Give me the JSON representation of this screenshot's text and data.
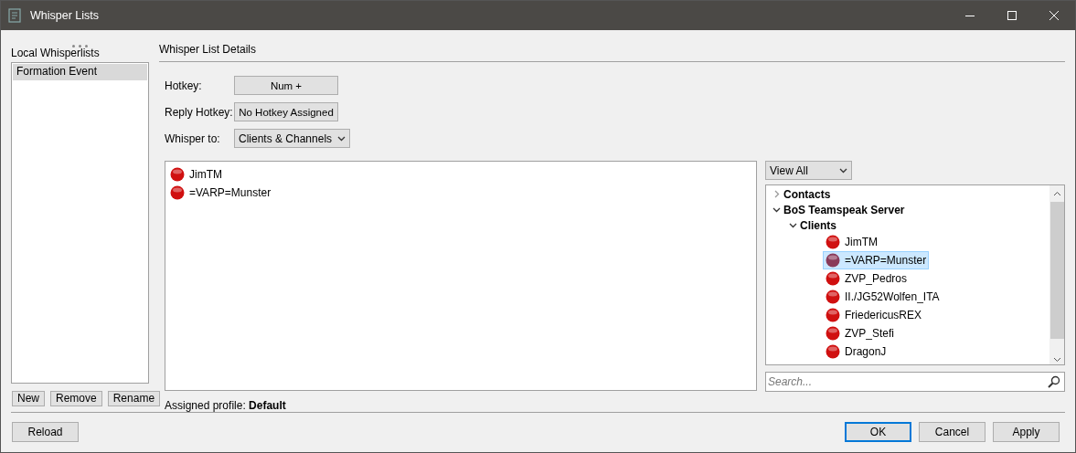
{
  "window": {
    "title": "Whisper Lists"
  },
  "local": {
    "title": "Local Whisperlists",
    "items": [
      {
        "label": "Formation Event",
        "selected": true
      }
    ],
    "buttons": [
      "New",
      "Remove",
      "Rename"
    ]
  },
  "details": {
    "title": "Whisper List Details",
    "fields": [
      {
        "kind": "button",
        "label": "Hotkey:",
        "value": "Num +"
      },
      {
        "kind": "button",
        "label": "Reply Hotkey:",
        "value": "No Hotkey Assigned"
      },
      {
        "kind": "dropdown",
        "label": "Whisper to:",
        "value": "Clients & Channels"
      }
    ],
    "targets": [
      {
        "name": "JimTM",
        "color": "#d01010"
      },
      {
        "name": "=VARP=Munster",
        "color": "#d01010"
      }
    ],
    "profile": "Assigned profile: **Default**"
  },
  "browser": {
    "filter": "View All",
    "search": {
      "placeholder": "Search..."
    },
    "tree": [
      {
        "label": "Contacts",
        "expanded": false
      },
      {
        "label": "BoS Teamspeak Server",
        "expanded": true,
        "children": [
          {
            "label": "Clients",
            "expanded": true,
            "children": [
              {
                "label": "JimTM",
                "color": "#d01010",
                "selected": false
              },
              {
                "label": "=VARP=Munster",
                "color": "#8a3a5a",
                "selected": true
              },
              {
                "label": "ZVP_Pedros",
                "color": "#d01010",
                "selected": false
              },
              {
                "label": "II./JG52Wolfen_ITA",
                "color": "#d01010",
                "selected": false
              },
              {
                "label": "FriedericusREX",
                "color": "#d01010",
                "selected": false
              },
              {
                "label": "ZVP_Stefi",
                "color": "#d01010",
                "selected": false
              },
              {
                "label": "DragonJ",
                "color": "#d01010",
                "selected": false
              }
            ]
          }
        ]
      }
    ]
  },
  "footer": {
    "left": "Reload",
    "right": [
      {
        "label": "OK",
        "selected": true
      },
      {
        "label": "Cancel",
        "selected": false
      },
      {
        "label": "Apply",
        "selected": false
      }
    ]
  }
}
